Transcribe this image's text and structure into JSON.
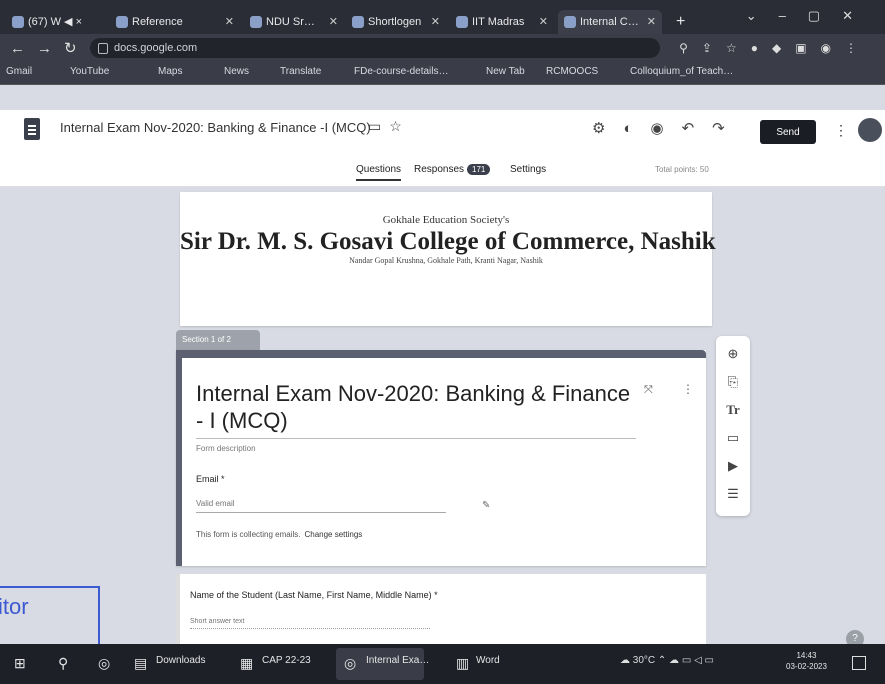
{
  "browser": {
    "tabs": [
      {
        "label": "(67) W ◀ ×"
      },
      {
        "label": "Reference"
      },
      {
        "label": "NDU Sr…"
      },
      {
        "label": "Shortlogen"
      },
      {
        "label": "IIT Madras"
      },
      {
        "label": "Internal C…"
      }
    ],
    "new_tab": "+",
    "url": "docs.google.com",
    "bookmarks": [
      "Gmail",
      "YouTube",
      "Maps",
      "News",
      "Translate",
      "FDe-course-details…",
      "New Tab",
      "RCMOOCS",
      "Colloquium_of Teach…"
    ]
  },
  "forms_header": {
    "title": "Internal Exam Nov-2020: Banking & Finance -I (MCQ)",
    "send_label": "Send",
    "tabs": {
      "questions": "Questions",
      "responses": "Responses",
      "responses_count": "171",
      "settings": "Settings"
    },
    "total_points": "Total points: 50"
  },
  "header_image": {
    "society": "Gokhale Education Society's",
    "college": "Sir Dr. M. S. Gosavi College of Commerce, Nashik",
    "address": "Nandar Gopal Krushna, Gokhale Path, Kranti Nagar, Nashik"
  },
  "section": {
    "tab_label": "Section 1 of 2",
    "form_title": "Internal Exam Nov-2020: Banking & Finance - I (MCQ)",
    "description_placeholder": "Form description",
    "email_label": "Email *",
    "email_placeholder": "Valid email",
    "collecting_note": "This form is collecting emails.",
    "change_settings": "Change settings"
  },
  "question": {
    "label": "Name of the Student (Last Name, First Name, Middle Name) *",
    "placeholder": "Short answer text"
  },
  "stamp_text": "itor",
  "taskbar": {
    "downloads": "Downloads",
    "cap": "CAP 22-23",
    "internal": "Internal Exa…",
    "word": "Word",
    "temp": "30°C",
    "time": "14:43",
    "date": "03-02-2023"
  }
}
